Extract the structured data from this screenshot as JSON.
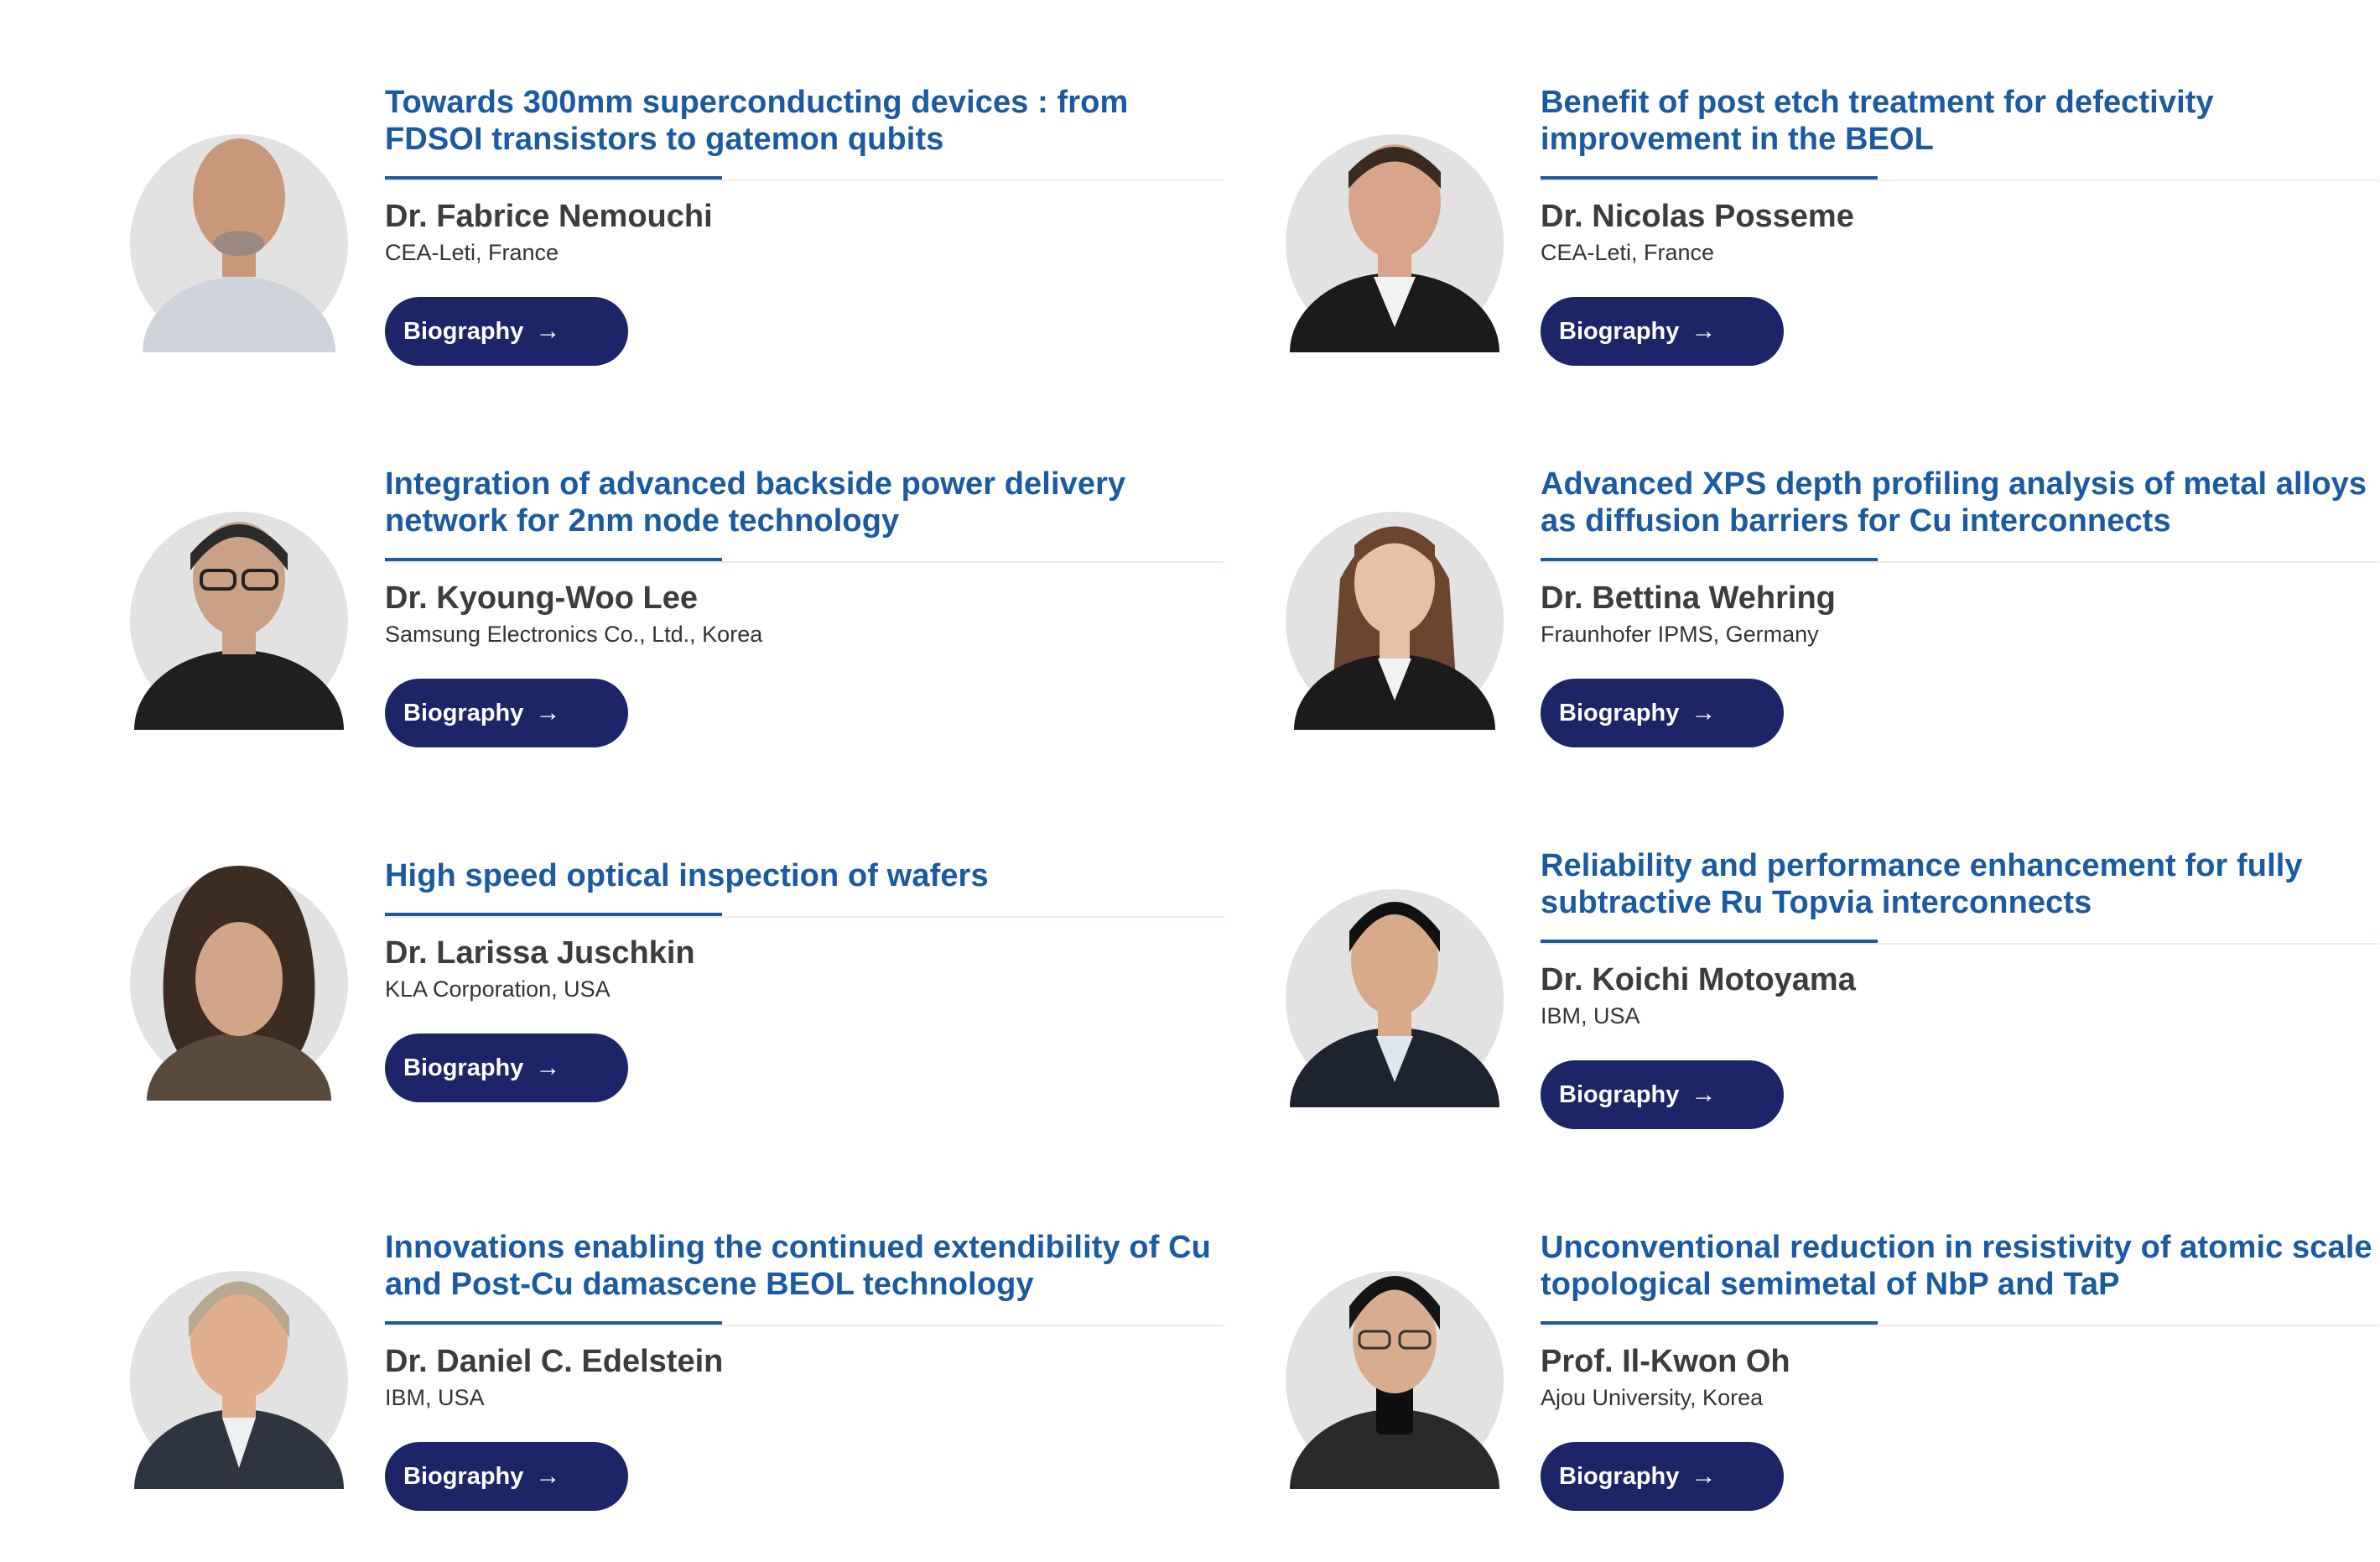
{
  "button_label": "Biography",
  "arrow_icon": "→",
  "colors": {
    "title": "#1a5aa0",
    "button_bg": "#1b2567",
    "name": "#3c3c3c"
  },
  "speakers": [
    {
      "title": "Towards 300mm superconducting devices : from FDSOI transistors to gatemon qubits",
      "name": "Dr. Fabrice Nemouchi",
      "affiliation": "CEA-Leti, France"
    },
    {
      "title": "Benefit of post etch treatment for defectivity improvement in the BEOL",
      "name": "Dr. Nicolas Posseme",
      "affiliation": "CEA-Leti, France"
    },
    {
      "title": "Integration of advanced backside power delivery network for 2nm node technology",
      "name": "Dr. Kyoung-Woo Lee",
      "affiliation": "Samsung Electronics Co., Ltd., Korea"
    },
    {
      "title": "Advanced XPS depth profiling analysis of metal alloys as diffusion barriers for Cu interconnects",
      "name": "Dr. Bettina Wehring",
      "affiliation": "Fraunhofer IPMS, Germany"
    },
    {
      "title": "High speed optical inspection of wafers",
      "name": "Dr. Larissa Juschkin",
      "affiliation": "KLA Corporation, USA"
    },
    {
      "title": "Reliability and performance enhancement for fully subtractive Ru Topvia interconnects",
      "name": "Dr. Koichi Motoyama",
      "affiliation": "IBM, USA"
    },
    {
      "title": "Innovations enabling the continued extendibility of Cu and Post-Cu damascene BEOL technology",
      "name": "Dr. Daniel C. Edelstein",
      "affiliation": "IBM, USA"
    },
    {
      "title": "Unconventional reduction in resistivity of atomic scale topological semimetal of NbP and TaP",
      "name": "Prof. Il-Kwon Oh",
      "affiliation": "Ajou University, Korea"
    }
  ]
}
